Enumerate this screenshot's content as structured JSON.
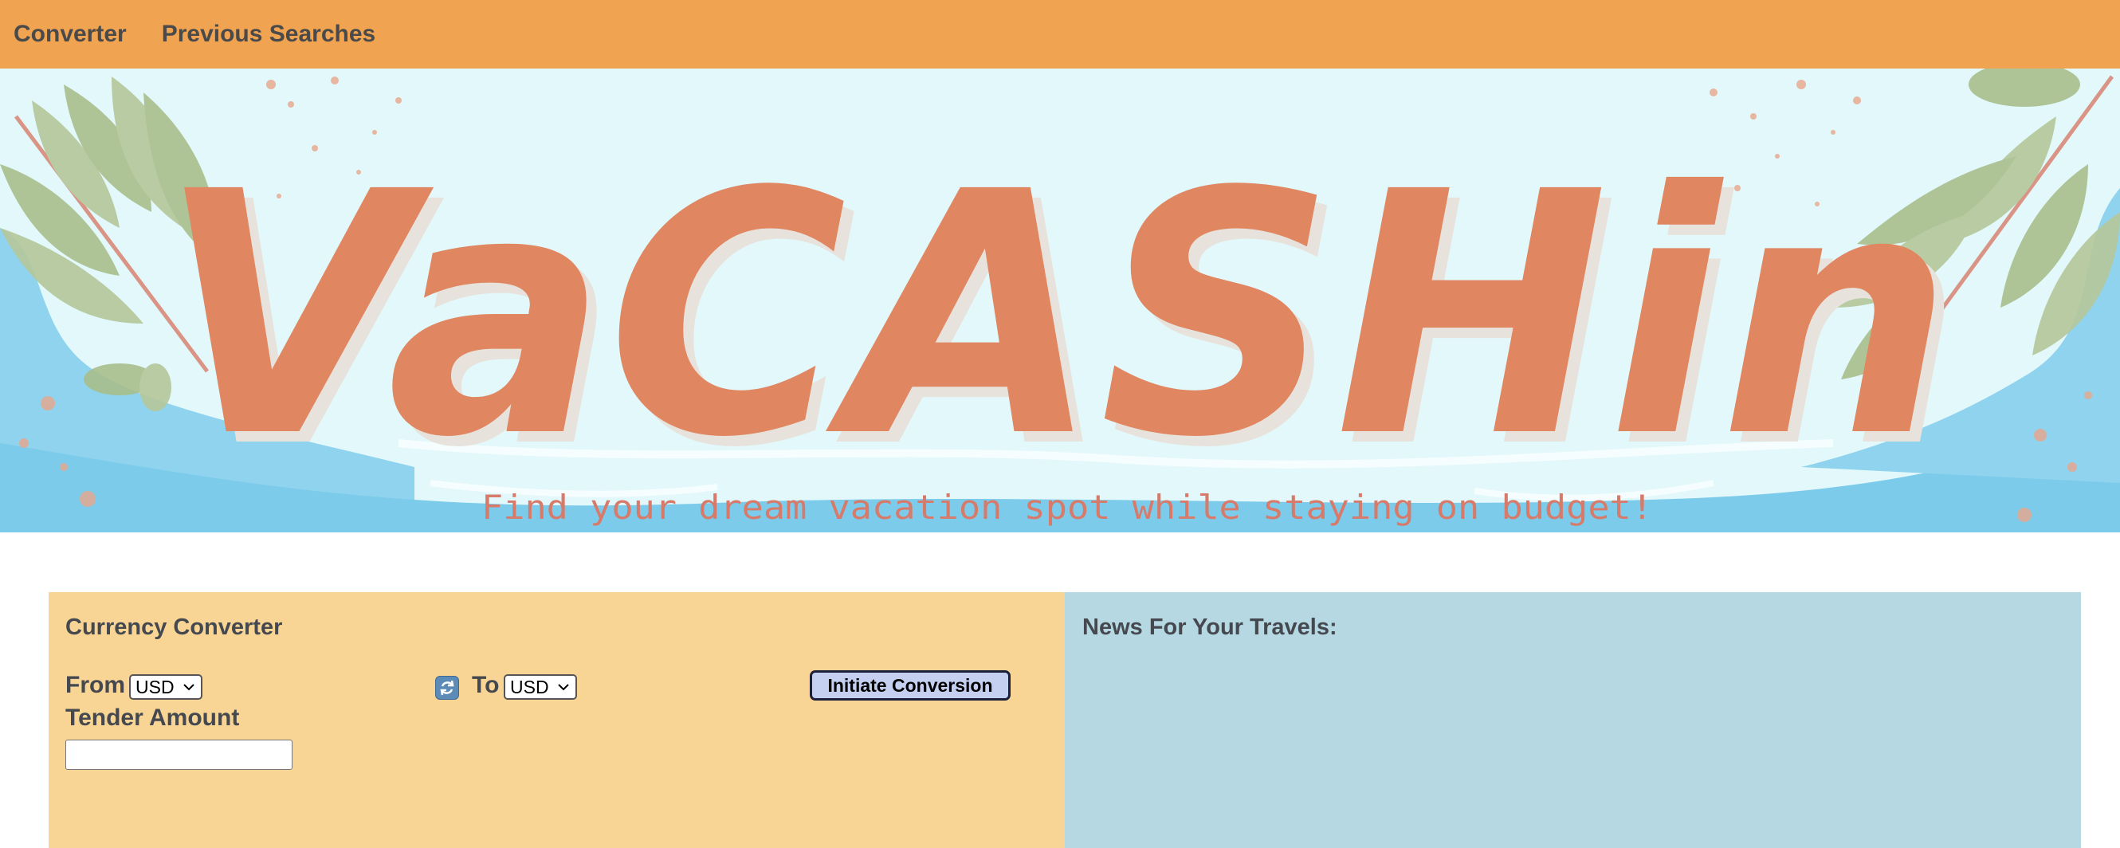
{
  "nav": {
    "links": [
      "Converter",
      "Previous Searches"
    ]
  },
  "banner": {
    "logo_text": "VaCASHin",
    "tagline": "Find your dream vacation spot while staying on budget!"
  },
  "converter": {
    "title": "Currency Converter",
    "from_label": "From",
    "from_value": "USD",
    "to_label": "To",
    "to_value": "USD",
    "button_label": "Initiate Conversion",
    "amount_label": "Tender Amount",
    "amount_value": ""
  },
  "news": {
    "title": "News For Your Travels:"
  },
  "colors": {
    "nav_bg": "#f0a350",
    "banner_bg": "#e2f8fb",
    "logo": "#e08661",
    "converter_bg": "#f8d594",
    "news_bg": "#b6d8e3"
  }
}
